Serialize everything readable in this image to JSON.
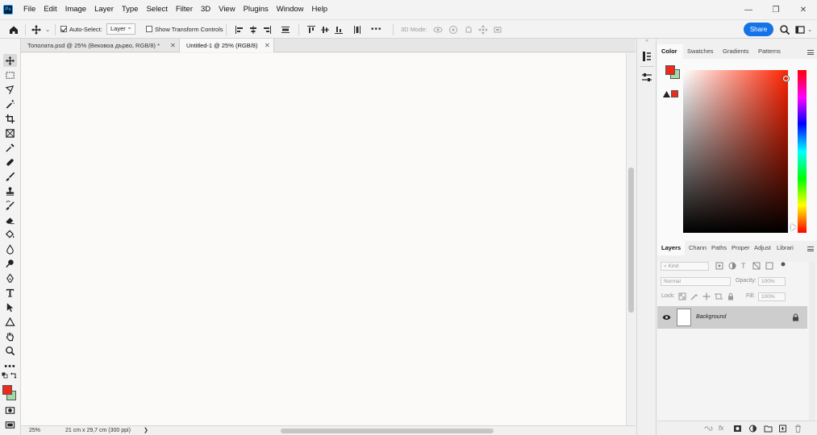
{
  "app": {
    "logo": "Ps"
  },
  "menu": [
    "File",
    "Edit",
    "Image",
    "Layer",
    "Type",
    "Select",
    "Filter",
    "3D",
    "View",
    "Plugins",
    "Window",
    "Help"
  ],
  "options": {
    "auto_select_label": "Auto-Select:",
    "auto_select_value": "Layer",
    "show_transform_label": "Show Transform Controls",
    "mode_3d_label": "3D Mode:",
    "share_label": "Share"
  },
  "tabs": [
    {
      "label": "Тополата.psd @ 25% (Вековоа дърво, RGB/8) *",
      "active": false
    },
    {
      "label": "Untitled-1 @ 25% (RGB/8)",
      "active": true
    }
  ],
  "status": {
    "zoom": "25%",
    "doc_size": "21 cm x 29,7 cm (300 ppi)",
    "arrow": "❯"
  },
  "color_panel": {
    "tabs": [
      "Color",
      "Swatches",
      "Gradients",
      "Patterns"
    ],
    "foreground": "#ee2a1a",
    "background": "#a6d8a8"
  },
  "layers_panel": {
    "tabs": [
      "Layers",
      "Chann",
      "Paths",
      "Proper",
      "Adjust",
      "Librari"
    ],
    "kind_placeholder": "Kind",
    "blend_mode": "Normal",
    "opacity_label": "Opacity:",
    "opacity_value": "100%",
    "lock_label": "Lock:",
    "fill_label": "Fill:",
    "fill_value": "100%",
    "layers": [
      {
        "name": "Background",
        "visible": true,
        "locked": true
      }
    ]
  },
  "colors": {
    "accent": "#1473e6",
    "fg_swatch": "#ee2a1a",
    "bg_swatch": "#a6d8a8"
  }
}
